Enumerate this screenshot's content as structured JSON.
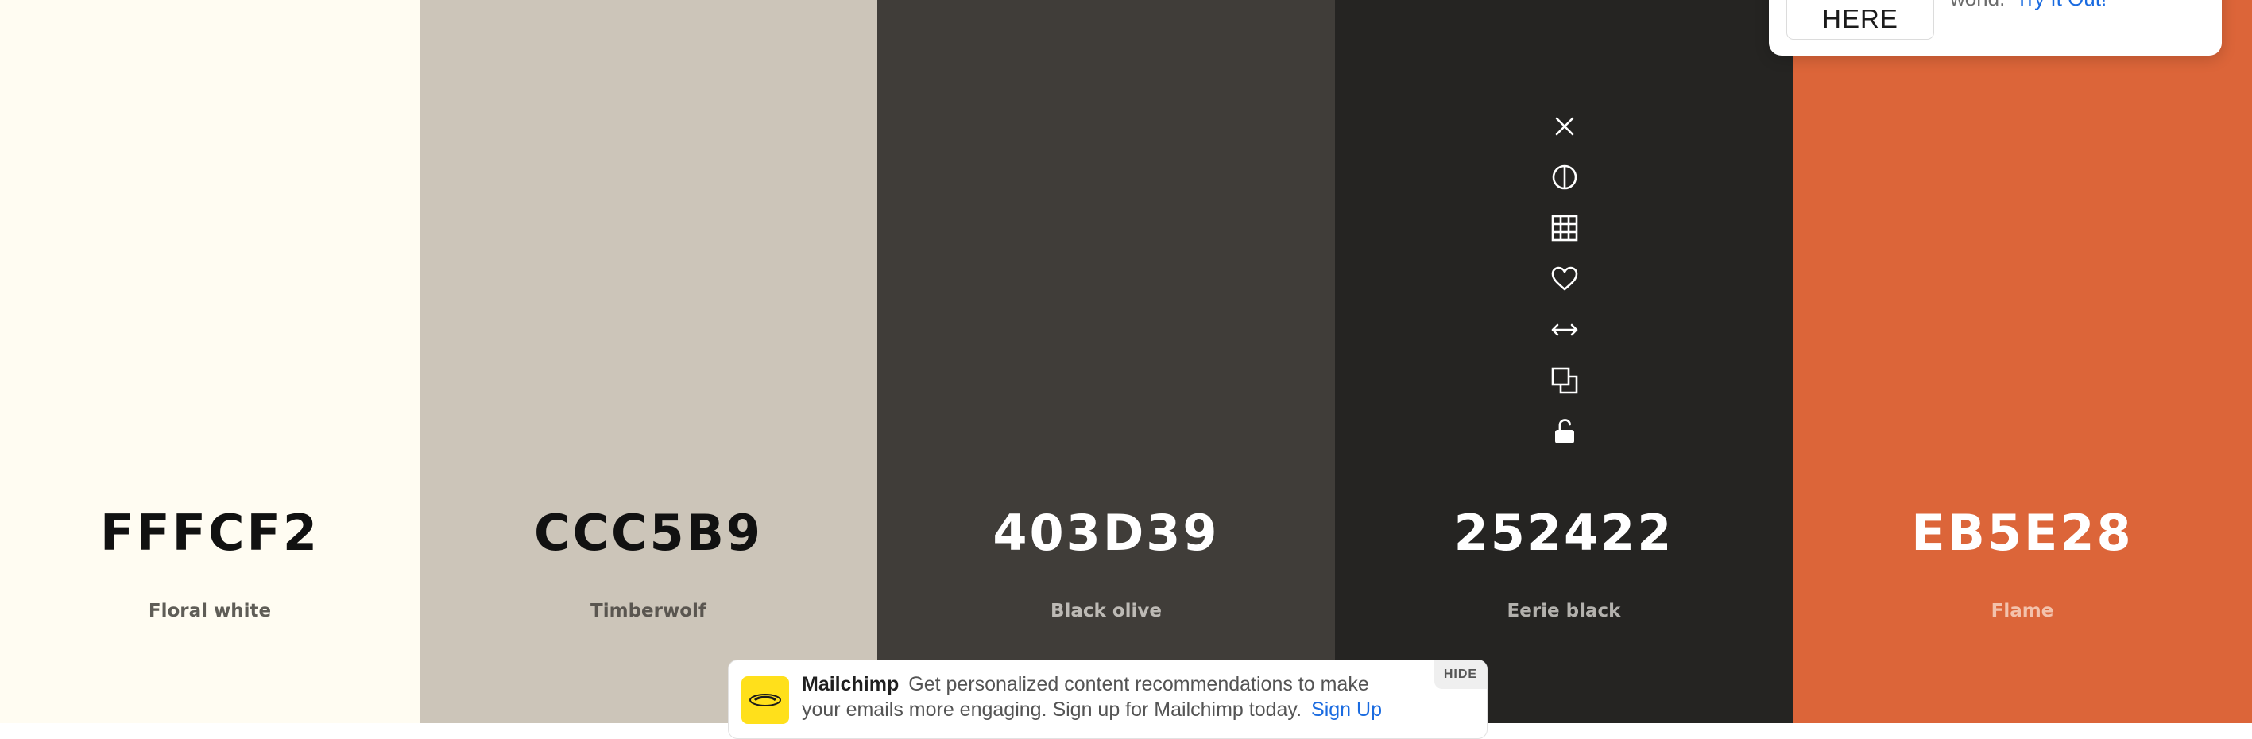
{
  "palette": {
    "swatches": [
      {
        "hex": "FFFCF2",
        "name": "Floral white",
        "bg": "#FFFCF2",
        "hex_color": "#111111",
        "name_color": "#5f5d57"
      },
      {
        "hex": "CCC5B9",
        "name": "Timberwolf",
        "bg": "#CCC5B9",
        "hex_color": "#111111",
        "name_color": "#5a5650"
      },
      {
        "hex": "403D39",
        "name": "Black olive",
        "bg": "#403D39",
        "hex_color": "#ffffff",
        "name_color": "#bdbab5"
      },
      {
        "hex": "252422",
        "name": "Eerie black",
        "bg": "#252422",
        "hex_color": "#ffffff",
        "name_color": "#b3b1ad"
      },
      {
        "hex": "EB5E28",
        "name": "Flame",
        "bg": "#DC6539",
        "hex_color": "#ffffff",
        "name_color": "#f3c2ac"
      }
    ],
    "toolbar_icons": [
      "close-icon",
      "contrast-icon",
      "shades-grid-icon",
      "heart-icon",
      "drag-arrows-icon",
      "copy-icon",
      "unlock-icon"
    ]
  },
  "promo": {
    "button_label": "HERE",
    "text": "world.",
    "link": "Try It Out!"
  },
  "ad": {
    "brand": "Mailchimp",
    "text": "Get personalized content recommendations to make your emails more engaging. Sign up for Mailchimp today.",
    "link": "Sign Up",
    "hide_label": "HIDE",
    "logo_color": "#FFE01B"
  }
}
